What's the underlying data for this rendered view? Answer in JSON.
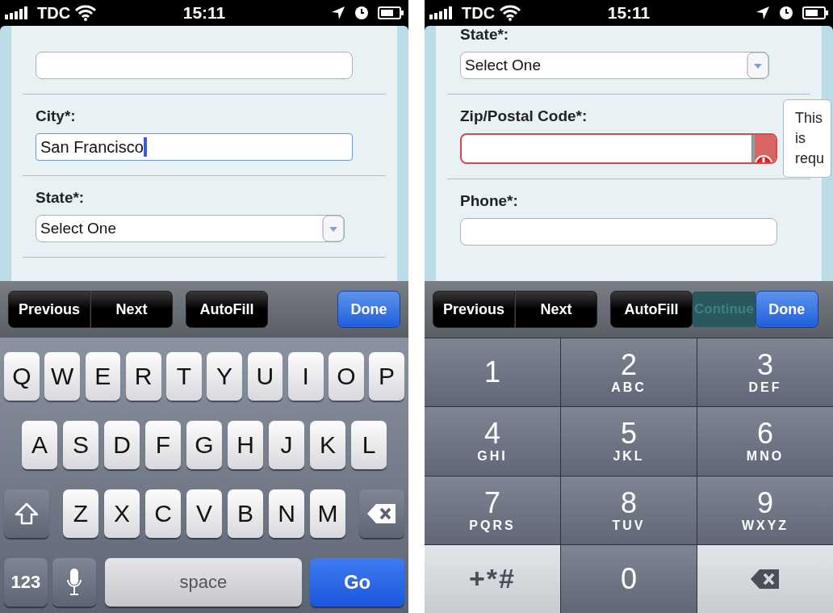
{
  "screens": [
    {
      "status_bar": {
        "carrier": "TDC",
        "time": "15:11"
      },
      "form": {
        "fields": [
          {
            "kind": "text",
            "focused": false,
            "error": false
          },
          {
            "kind": "text",
            "label": "City*:",
            "value": "San Francisco",
            "focused": true,
            "error": false
          },
          {
            "kind": "select",
            "label": "State*:",
            "value": "Select One"
          }
        ]
      },
      "toolbar": {
        "buttons": [
          {
            "kind": "segment",
            "label": "Previous"
          },
          {
            "kind": "segment",
            "label": "Next"
          },
          {
            "kind": "plain",
            "label": "AutoFill"
          },
          {
            "kind": "primary",
            "label": "Done"
          }
        ]
      },
      "keyboard": {
        "kind": "alpha",
        "rows": [
          {
            "keys": [
              {
                "kind": "letter",
                "label": "Q"
              },
              {
                "kind": "letter",
                "label": "W"
              },
              {
                "kind": "letter",
                "label": "E"
              },
              {
                "kind": "letter",
                "label": "R"
              },
              {
                "kind": "letter",
                "label": "T"
              },
              {
                "kind": "letter",
                "label": "Y"
              },
              {
                "kind": "letter",
                "label": "U"
              },
              {
                "kind": "letter",
                "label": "I"
              },
              {
                "kind": "letter",
                "label": "O"
              },
              {
                "kind": "letter",
                "label": "P"
              }
            ]
          },
          {
            "keys": [
              {
                "kind": "letter",
                "label": "A"
              },
              {
                "kind": "letter",
                "label": "S"
              },
              {
                "kind": "letter",
                "label": "D"
              },
              {
                "kind": "letter",
                "label": "F"
              },
              {
                "kind": "letter",
                "label": "G"
              },
              {
                "kind": "letter",
                "label": "H"
              },
              {
                "kind": "letter",
                "label": "J"
              },
              {
                "kind": "letter",
                "label": "K"
              },
              {
                "kind": "letter",
                "label": "L"
              }
            ]
          },
          {
            "keys": [
              {
                "kind": "shift"
              },
              {
                "kind": "letter",
                "label": "Z"
              },
              {
                "kind": "letter",
                "label": "X"
              },
              {
                "kind": "letter",
                "label": "C"
              },
              {
                "kind": "letter",
                "label": "V"
              },
              {
                "kind": "letter",
                "label": "B"
              },
              {
                "kind": "letter",
                "label": "N"
              },
              {
                "kind": "letter",
                "label": "M"
              },
              {
                "kind": "delete"
              }
            ]
          },
          {
            "keys": [
              {
                "kind": "mode",
                "label": "123"
              },
              {
                "kind": "mic"
              },
              {
                "kind": "space",
                "label": "space"
              },
              {
                "kind": "go",
                "label": "Go"
              }
            ]
          }
        ]
      }
    },
    {
      "status_bar": {
        "carrier": "TDC",
        "time": "15:11"
      },
      "form": {
        "fields": [
          {
            "kind": "select",
            "label": "State*:",
            "value": "Select One"
          },
          {
            "kind": "text",
            "label": "Zip/Postal Code*:",
            "focused": false,
            "error": true,
            "error_message": "This is requ"
          },
          {
            "kind": "text",
            "label": "Phone*:",
            "focused": false,
            "error": false
          }
        ]
      },
      "submit_button": {
        "label": "Continue"
      },
      "toolbar": {
        "buttons": [
          {
            "kind": "segment",
            "label": "Previous"
          },
          {
            "kind": "segment",
            "label": "Next"
          },
          {
            "kind": "plain",
            "label": "AutoFill"
          },
          {
            "kind": "primary",
            "label": "Done"
          }
        ]
      },
      "keyboard": {
        "kind": "numeric",
        "rows": [
          [
            {
              "kind": "digit",
              "label": "1"
            },
            {
              "kind": "digit",
              "label": "2",
              "letters": "ABC"
            },
            {
              "kind": "digit",
              "label": "3",
              "letters": "DEF"
            }
          ],
          [
            {
              "kind": "digit",
              "label": "4",
              "letters": "GHI"
            },
            {
              "kind": "digit",
              "label": "5",
              "letters": "JKL"
            },
            {
              "kind": "digit",
              "label": "6",
              "letters": "MNO"
            }
          ],
          [
            {
              "kind": "digit",
              "label": "7",
              "letters": "PQRS"
            },
            {
              "kind": "digit",
              "label": "8",
              "letters": "TUV"
            },
            {
              "kind": "digit",
              "label": "9",
              "letters": "WXYZ"
            }
          ],
          [
            {
              "kind": "symbols",
              "label": "+*#"
            },
            {
              "kind": "digit",
              "label": "0"
            },
            {
              "kind": "delete"
            }
          ]
        ]
      }
    }
  ]
}
